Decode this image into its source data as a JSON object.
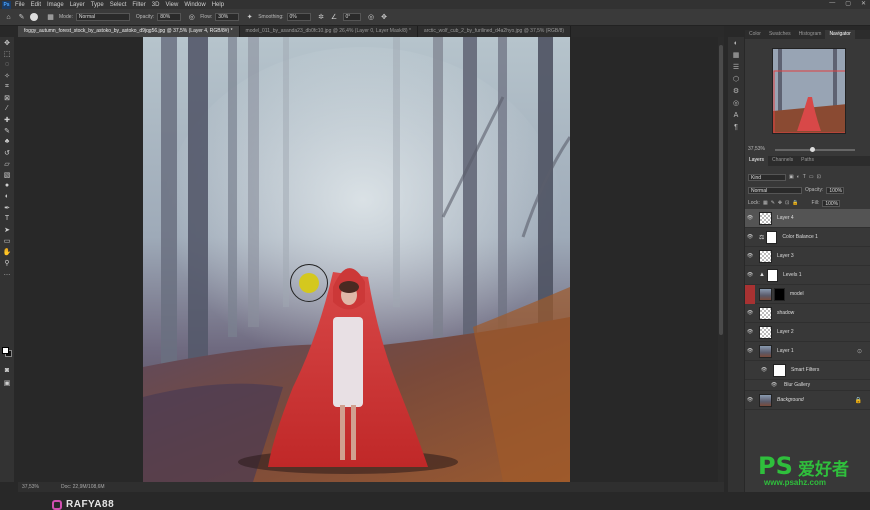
{
  "app": {
    "logo": "Ps"
  },
  "menu": [
    "File",
    "Edit",
    "Image",
    "Layer",
    "Type",
    "Select",
    "Filter",
    "3D",
    "View",
    "Window",
    "Help"
  ],
  "window_controls": [
    "—",
    "▢",
    "✕"
  ],
  "options": {
    "mode_label": "Mode:",
    "mode_value": "Normal",
    "opacity_label": "Opacity:",
    "opacity_value": "80%",
    "flow_label": "Flow:",
    "flow_value": "30%",
    "smoothing_label": "Smoothing:",
    "smoothing_value": "0%",
    "angle_value": "0°"
  },
  "tabs": [
    {
      "label": "foggy_autumn_forest_stock_by_astoko_by_astoko_d9jqg56.jpg @ 37,5% (Layer 4, RGB/8#) *",
      "active": true
    },
    {
      "label": "model_011_by_asanda23_db0fc10.jpg @ 26,4% (Layer 0, Layer Mask/8) *",
      "active": false
    },
    {
      "label": "arctic_wolf_cub_2_by_furilined_d4a2hyo.jpg @ 37,5% (RGB/8)",
      "active": false
    }
  ],
  "status": {
    "zoom": "37,53%",
    "doc": "Doc: 22,9M/108,6M"
  },
  "watermark_left": "RAFYA88",
  "panel_tabs": [
    "Color",
    "Swatches",
    "Histogram",
    "Navigator"
  ],
  "active_panel_tab": "Navigator",
  "navigator_zoom": "37,53%",
  "layers_tabs": [
    "Layers",
    "Channels",
    "Paths"
  ],
  "layers_kind": "Kind",
  "blend_mode": "Normal",
  "opacity_label": "Opacity:",
  "opacity_value": "100%",
  "lock_label": "Lock:",
  "fill_label": "Fill:",
  "fill_value": "100%",
  "layers": [
    {
      "name": "Layer 4",
      "thumb": "transparent",
      "active": true
    },
    {
      "name": "Color Balance 1",
      "thumb": "adjust",
      "mask": "white"
    },
    {
      "name": "Layer 3",
      "thumb": "transparent"
    },
    {
      "name": "Levels 1",
      "thumb": "adjust",
      "mask": "white"
    },
    {
      "name": "model",
      "thumb": "photo",
      "mask": "dark",
      "eye_red": true
    },
    {
      "name": "shadow",
      "thumb": "transparent"
    },
    {
      "name": "Layer 2",
      "thumb": "transparent"
    },
    {
      "name": "Layer 1",
      "thumb": "photo"
    },
    {
      "name": "Smart Filters",
      "thumb": "white",
      "indent": true
    },
    {
      "name": "Blur Gallery",
      "sub": true
    },
    {
      "name": "Background",
      "thumb": "photo",
      "italic": true,
      "locked": true
    }
  ],
  "watermark_right": {
    "ps": "PS",
    "cn": "爱好者",
    "url": "www.psahz.com"
  },
  "colors": {
    "accent": "#2fbf3c",
    "cape": "#e04848",
    "cursor": "#d4c81e"
  }
}
